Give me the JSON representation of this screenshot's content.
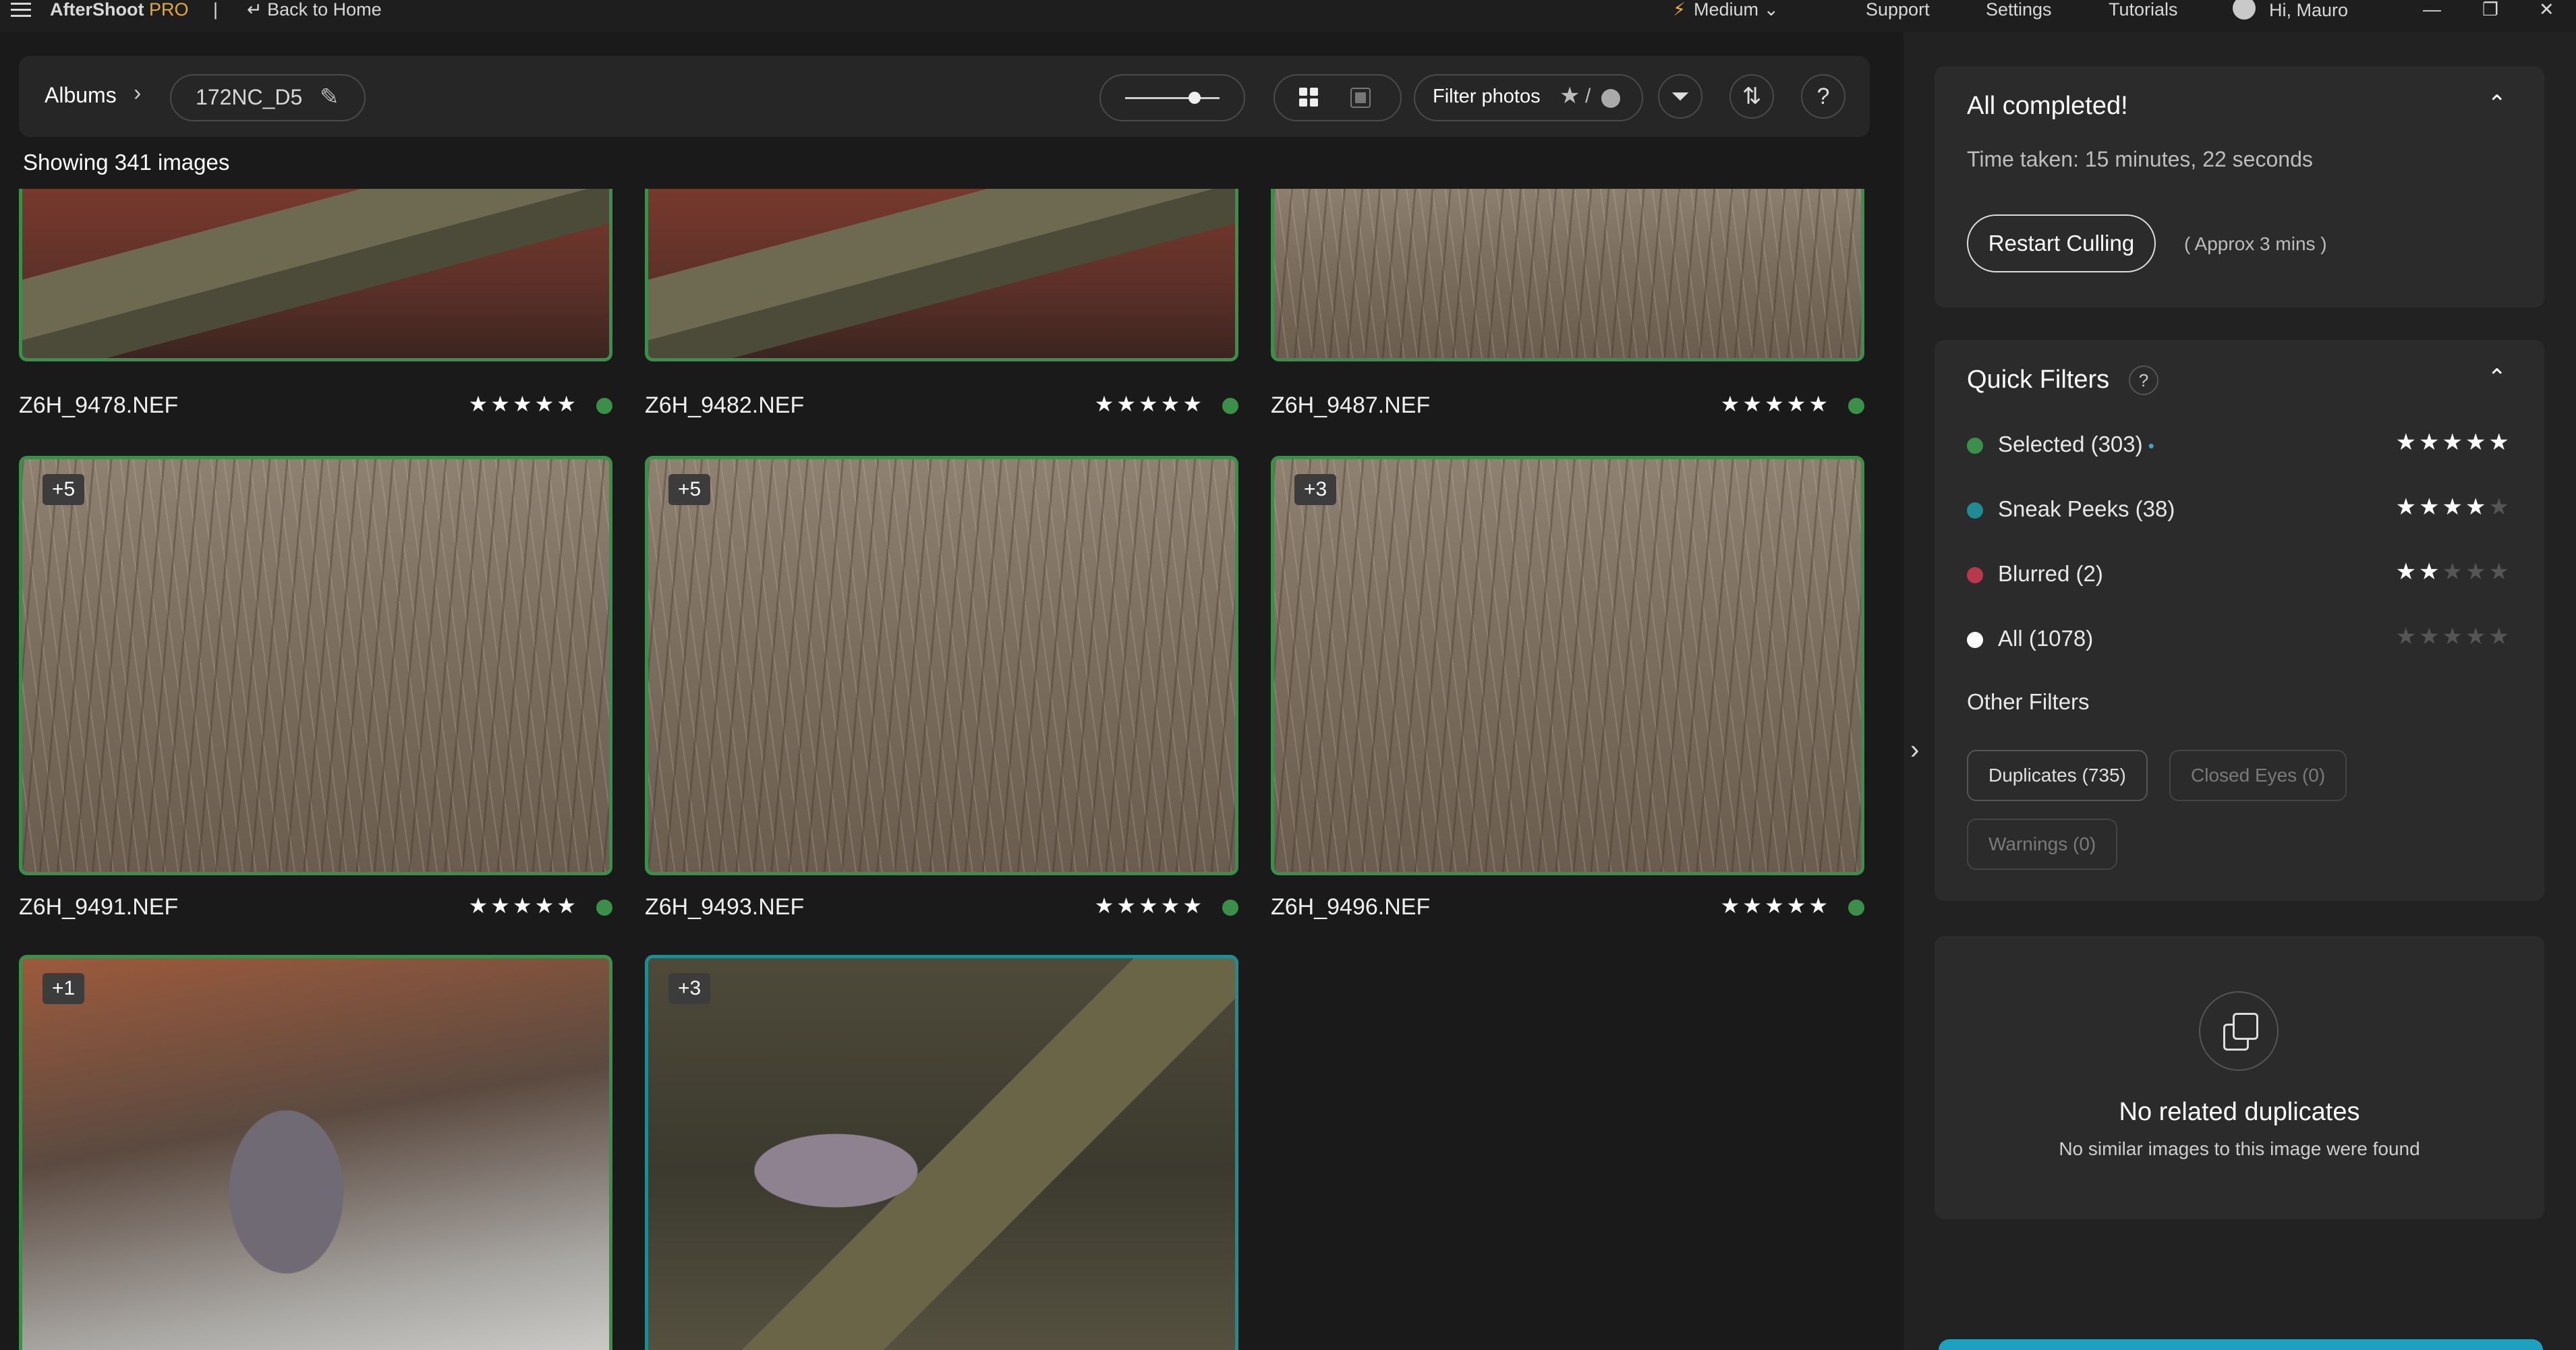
{
  "titlebar": {
    "brand": "AfterShoot",
    "brand_pro": "PRO",
    "separator": "|",
    "back": "Back to Home",
    "mode": "Medium",
    "support": "Support",
    "settings": "Settings",
    "tutorials": "Tutorials",
    "user": "Hi, Mauro"
  },
  "toolbar": {
    "albums": "Albums",
    "album_name": "172NC_D5",
    "filter_label": "Filter photos",
    "filter_sep": "/"
  },
  "showing": "Showing 341 images",
  "photos": [
    {
      "name": "Z6H_9478.NEF",
      "stars": "★★★★★",
      "badge": ""
    },
    {
      "name": "Z6H_9482.NEF",
      "stars": "★★★★★",
      "badge": ""
    },
    {
      "name": "Z6H_9487.NEF",
      "stars": "★★★★★",
      "badge": ""
    },
    {
      "name": "Z6H_9491.NEF",
      "stars": "★★★★★",
      "badge": "+5"
    },
    {
      "name": "Z6H_9493.NEF",
      "stars": "★★★★★",
      "badge": "+5"
    },
    {
      "name": "Z6H_9496.NEF",
      "stars": "★★★★★",
      "badge": "+3"
    },
    {
      "name": "",
      "stars": "",
      "badge": "+1"
    },
    {
      "name": "",
      "stars": "",
      "badge": "+3"
    }
  ],
  "status": {
    "title": "All completed!",
    "time": "Time taken: 15 minutes, 22 seconds",
    "restart": "Restart Culling",
    "approx": "( Approx 3 mins )"
  },
  "quick_filters": {
    "title": "Quick Filters",
    "help": "?",
    "items": [
      {
        "label": "Selected (303)",
        "color": "#3b8f4a",
        "on": "★★★★★",
        "off": ""
      },
      {
        "label": "Sneak Peeks (38)",
        "color": "#1f8c94",
        "on": "★★★★",
        "off": "★"
      },
      {
        "label": "Blurred (2)",
        "color": "#b83a4a",
        "on": "★★",
        "off": "★★★"
      },
      {
        "label": "All (1078)",
        "color": "#ffffff",
        "on": "",
        "off": "★★★★★"
      }
    ],
    "other_title": "Other Filters",
    "chips": [
      "Duplicates (735)",
      "Closed Eyes (0)",
      "Warnings (0)"
    ]
  },
  "duplicates": {
    "title": "No related duplicates",
    "subtitle": "No similar images to this image were found"
  },
  "colors": {
    "selected": "#3b8f4a",
    "sneak": "#1f8c94",
    "accent": "#1ea0c0"
  }
}
